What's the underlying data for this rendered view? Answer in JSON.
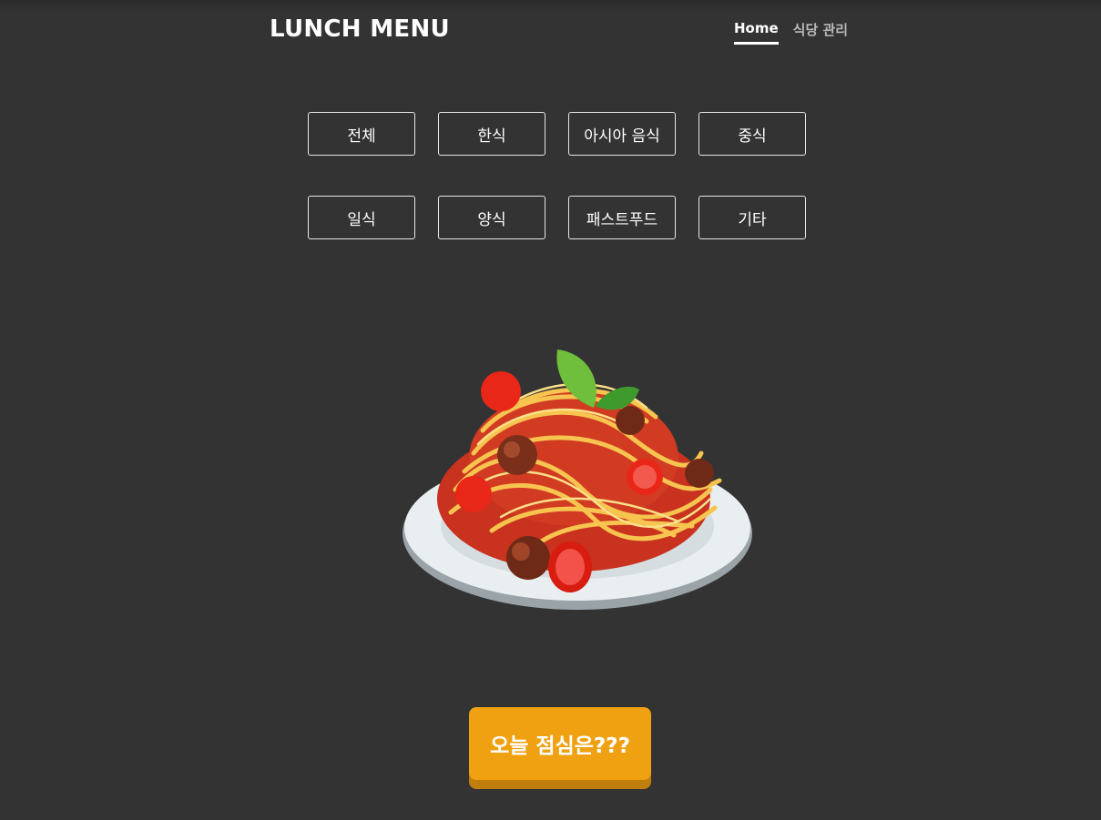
{
  "header": {
    "title": "LUNCH MENU",
    "nav": [
      {
        "label": "Home",
        "active": true
      },
      {
        "label": "식당 관리",
        "active": false
      }
    ]
  },
  "categories": {
    "row1": [
      "전체",
      "한식",
      "아시아 음식",
      "중식"
    ],
    "row2": [
      "일식",
      "양식",
      "패스트푸드",
      "기타"
    ]
  },
  "hero": {
    "icon": "spaghetti-plate-icon"
  },
  "cta": {
    "label": "오늘 점심은???",
    "color": "#efa112"
  },
  "theme": {
    "background": "#333333"
  }
}
